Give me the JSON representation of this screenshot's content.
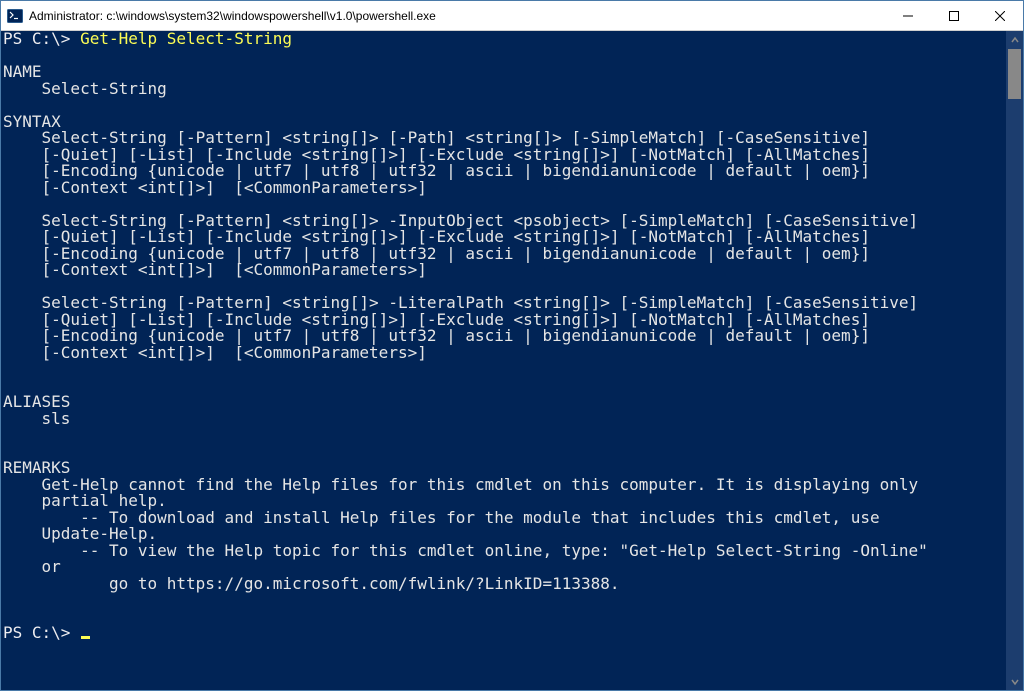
{
  "titlebar": {
    "text": "Administrator: c:\\windows\\system32\\windowspowershell\\v1.0\\powershell.exe"
  },
  "console": {
    "prompt1_ps": "PS C:\\> ",
    "prompt1_cmd": "Get-Help Select-String",
    "blank": "",
    "name_hdr": "NAME",
    "name_val": "    Select-String",
    "syntax_hdr": "SYNTAX",
    "syntax_b1_l1": "    Select-String [-Pattern] <string[]> [-Path] <string[]> [-SimpleMatch] [-CaseSensitive]",
    "syntax_b1_l2": "    [-Quiet] [-List] [-Include <string[]>] [-Exclude <string[]>] [-NotMatch] [-AllMatches]",
    "syntax_b1_l3": "    [-Encoding {unicode | utf7 | utf8 | utf32 | ascii | bigendianunicode | default | oem}]",
    "syntax_b1_l4": "    [-Context <int[]>]  [<CommonParameters>]",
    "syntax_b2_l1": "    Select-String [-Pattern] <string[]> -InputObject <psobject> [-SimpleMatch] [-CaseSensitive]",
    "syntax_b2_l2": "    [-Quiet] [-List] [-Include <string[]>] [-Exclude <string[]>] [-NotMatch] [-AllMatches]",
    "syntax_b2_l3": "    [-Encoding {unicode | utf7 | utf8 | utf32 | ascii | bigendianunicode | default | oem}]",
    "syntax_b2_l4": "    [-Context <int[]>]  [<CommonParameters>]",
    "syntax_b3_l1": "    Select-String [-Pattern] <string[]> -LiteralPath <string[]> [-SimpleMatch] [-CaseSensitive]",
    "syntax_b3_l2": "    [-Quiet] [-List] [-Include <string[]>] [-Exclude <string[]>] [-NotMatch] [-AllMatches]",
    "syntax_b3_l3": "    [-Encoding {unicode | utf7 | utf8 | utf32 | ascii | bigendianunicode | default | oem}]",
    "syntax_b3_l4": "    [-Context <int[]>]  [<CommonParameters>]",
    "aliases_hdr": "ALIASES",
    "aliases_val": "    sls",
    "remarks_hdr": "REMARKS",
    "remarks_l1": "    Get-Help cannot find the Help files for this cmdlet on this computer. It is displaying only",
    "remarks_l2": "    partial help.",
    "remarks_l3": "        -- To download and install Help files for the module that includes this cmdlet, use",
    "remarks_l4": "    Update-Help.",
    "remarks_l5": "        -- To view the Help topic for this cmdlet online, type: \"Get-Help Select-String -Online\"",
    "remarks_l6": "    or",
    "remarks_l7": "           go to https://go.microsoft.com/fwlink/?LinkID=113388.",
    "prompt2_ps": "PS C:\\> "
  }
}
